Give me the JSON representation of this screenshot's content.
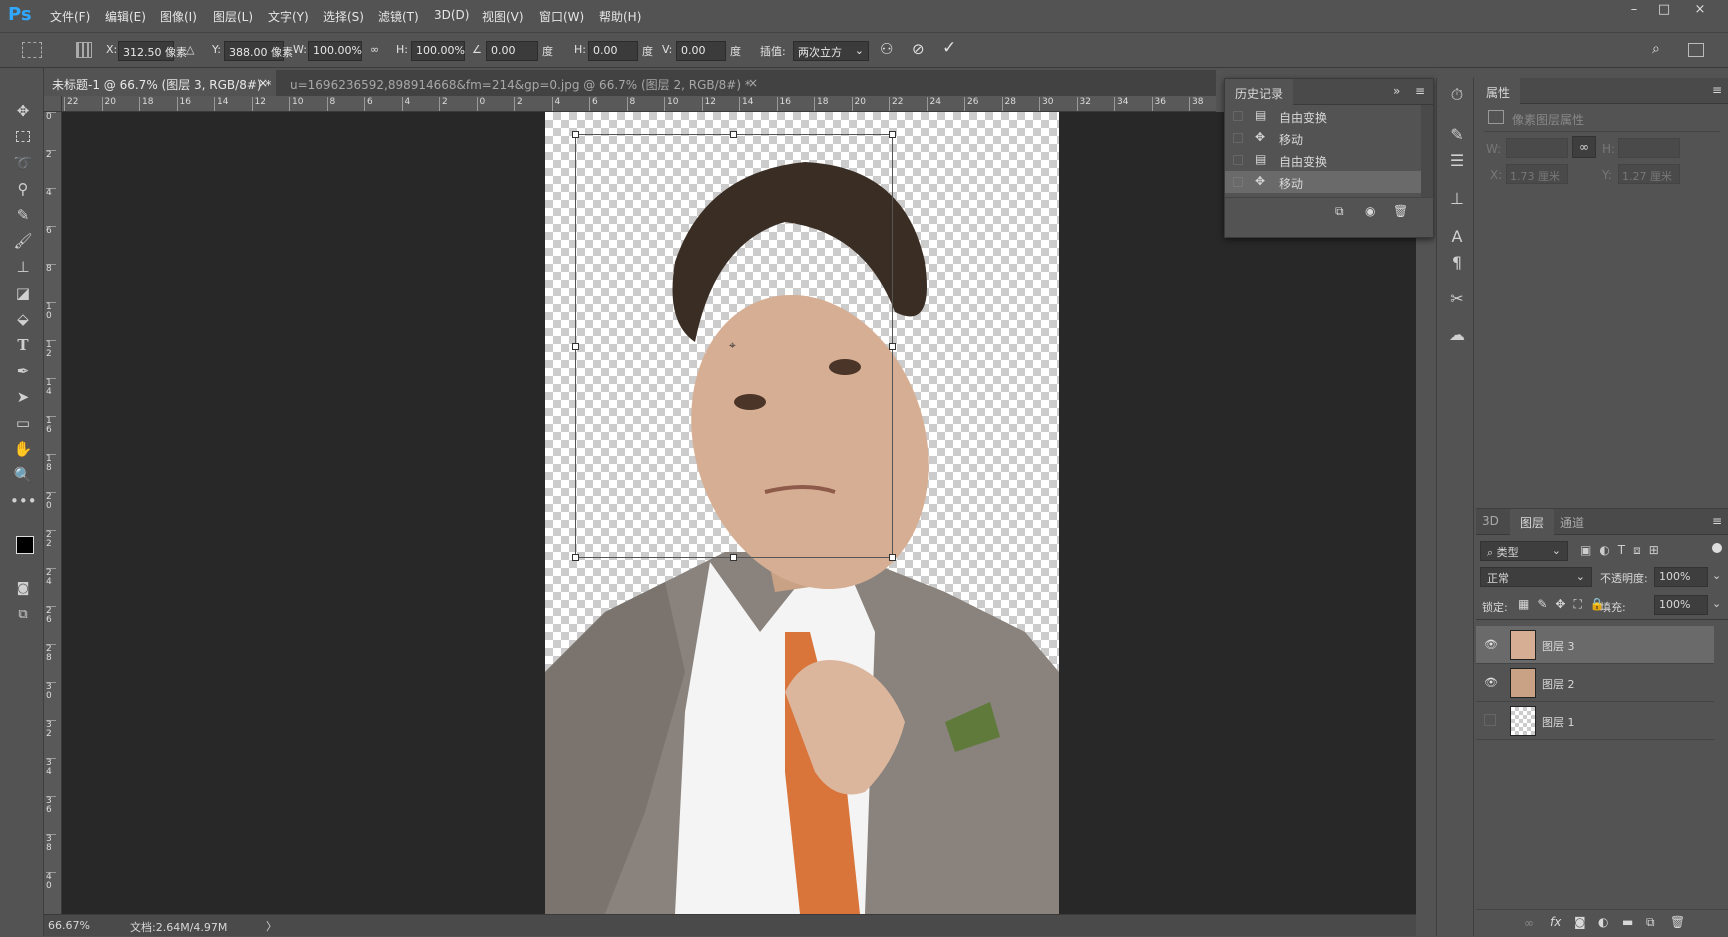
{
  "app": {
    "logo": "Ps"
  },
  "menu": [
    "文件(F)",
    "编辑(E)",
    "图像(I)",
    "图层(L)",
    "文字(Y)",
    "选择(S)",
    "滤镜(T)",
    "3D(D)",
    "视图(V)",
    "窗口(W)",
    "帮助(H)"
  ],
  "window_controls": {
    "minimize": "–",
    "restore": "□",
    "close": "×"
  },
  "options": {
    "x_label": "X:",
    "x_value": "312.50 像素",
    "y_label": "Y:",
    "y_value": "388.00 像素",
    "w_label": "W:",
    "w_value": "100.00%",
    "h_label": "H:",
    "h_value": "100.00%",
    "angle_value": "0.00",
    "angle_unit": "度",
    "hskew_label": "H:",
    "hskew_value": "0.00",
    "hskew_unit": "度",
    "vskew_label": "V:",
    "vskew_value": "0.00",
    "vskew_unit": "度",
    "interp_label": "插值:",
    "interp_value": "两次立方"
  },
  "tabs": [
    {
      "label": "未标题-1 @ 66.7% (图层 3, RGB/8#) *",
      "close": "×",
      "active": true
    },
    {
      "label": "u=1696236592,898914668&fm=214&gp=0.jpg @ 66.7% (图层 2, RGB/8#) *",
      "close": "×",
      "active": false
    }
  ],
  "ruler_top": [
    "22",
    "20",
    "18",
    "16",
    "14",
    "12",
    "10",
    "8",
    "6",
    "4",
    "2",
    "0",
    "2",
    "4",
    "6",
    "8",
    "10",
    "12",
    "14",
    "16",
    "18",
    "20",
    "22",
    "24",
    "26",
    "28",
    "30",
    "32",
    "34",
    "36",
    "38"
  ],
  "ruler_left": [
    "0",
    "2",
    "4",
    "6",
    "8",
    "1 0",
    "1 2",
    "1 4",
    "1 6",
    "1 8",
    "2 0",
    "2 2",
    "2 4",
    "2 6",
    "2 8",
    "3 0",
    "3 2",
    "3 4",
    "3 6",
    "3 8",
    "4 0"
  ],
  "status": {
    "zoom": "66.67%",
    "doc": "文档:2.64M/4.97M",
    "arrow": "〉"
  },
  "history": {
    "title": "历史记录",
    "expand": "»",
    "items": [
      {
        "label": "自由变换",
        "icon": "doc-icon"
      },
      {
        "label": "移动",
        "icon": "move-icon"
      },
      {
        "label": "自由变换",
        "icon": "doc-icon"
      },
      {
        "label": "移动",
        "icon": "move-icon",
        "selected": true
      }
    ]
  },
  "properties": {
    "title": "属性",
    "subtitle": "像素图层属性",
    "w_label": "W:",
    "h_label": "H:",
    "x_label": "X:",
    "x_value": "1.73 厘米",
    "y_label": "Y:",
    "y_value": "1.27 厘米"
  },
  "layers": {
    "tabs": [
      "3D",
      "图层",
      "通道"
    ],
    "active_tab": "图层",
    "filter_label": "类型",
    "blend_mode": "正常",
    "opacity_label": "不透明度:",
    "opacity_value": "100%",
    "lock_label": "锁定:",
    "fill_label": "填充:",
    "fill_value": "100%",
    "items": [
      {
        "name": "图层 3",
        "visible": true,
        "selected": true
      },
      {
        "name": "图层 2",
        "visible": true,
        "selected": false
      },
      {
        "name": "图层 1",
        "visible": false,
        "selected": false
      }
    ],
    "footer_fx": "fx"
  },
  "colors": {
    "accent": "#31a8ff",
    "panel": "#535353",
    "workspace": "#282828",
    "tie": "#d9743a",
    "suit": "#8a837d"
  }
}
